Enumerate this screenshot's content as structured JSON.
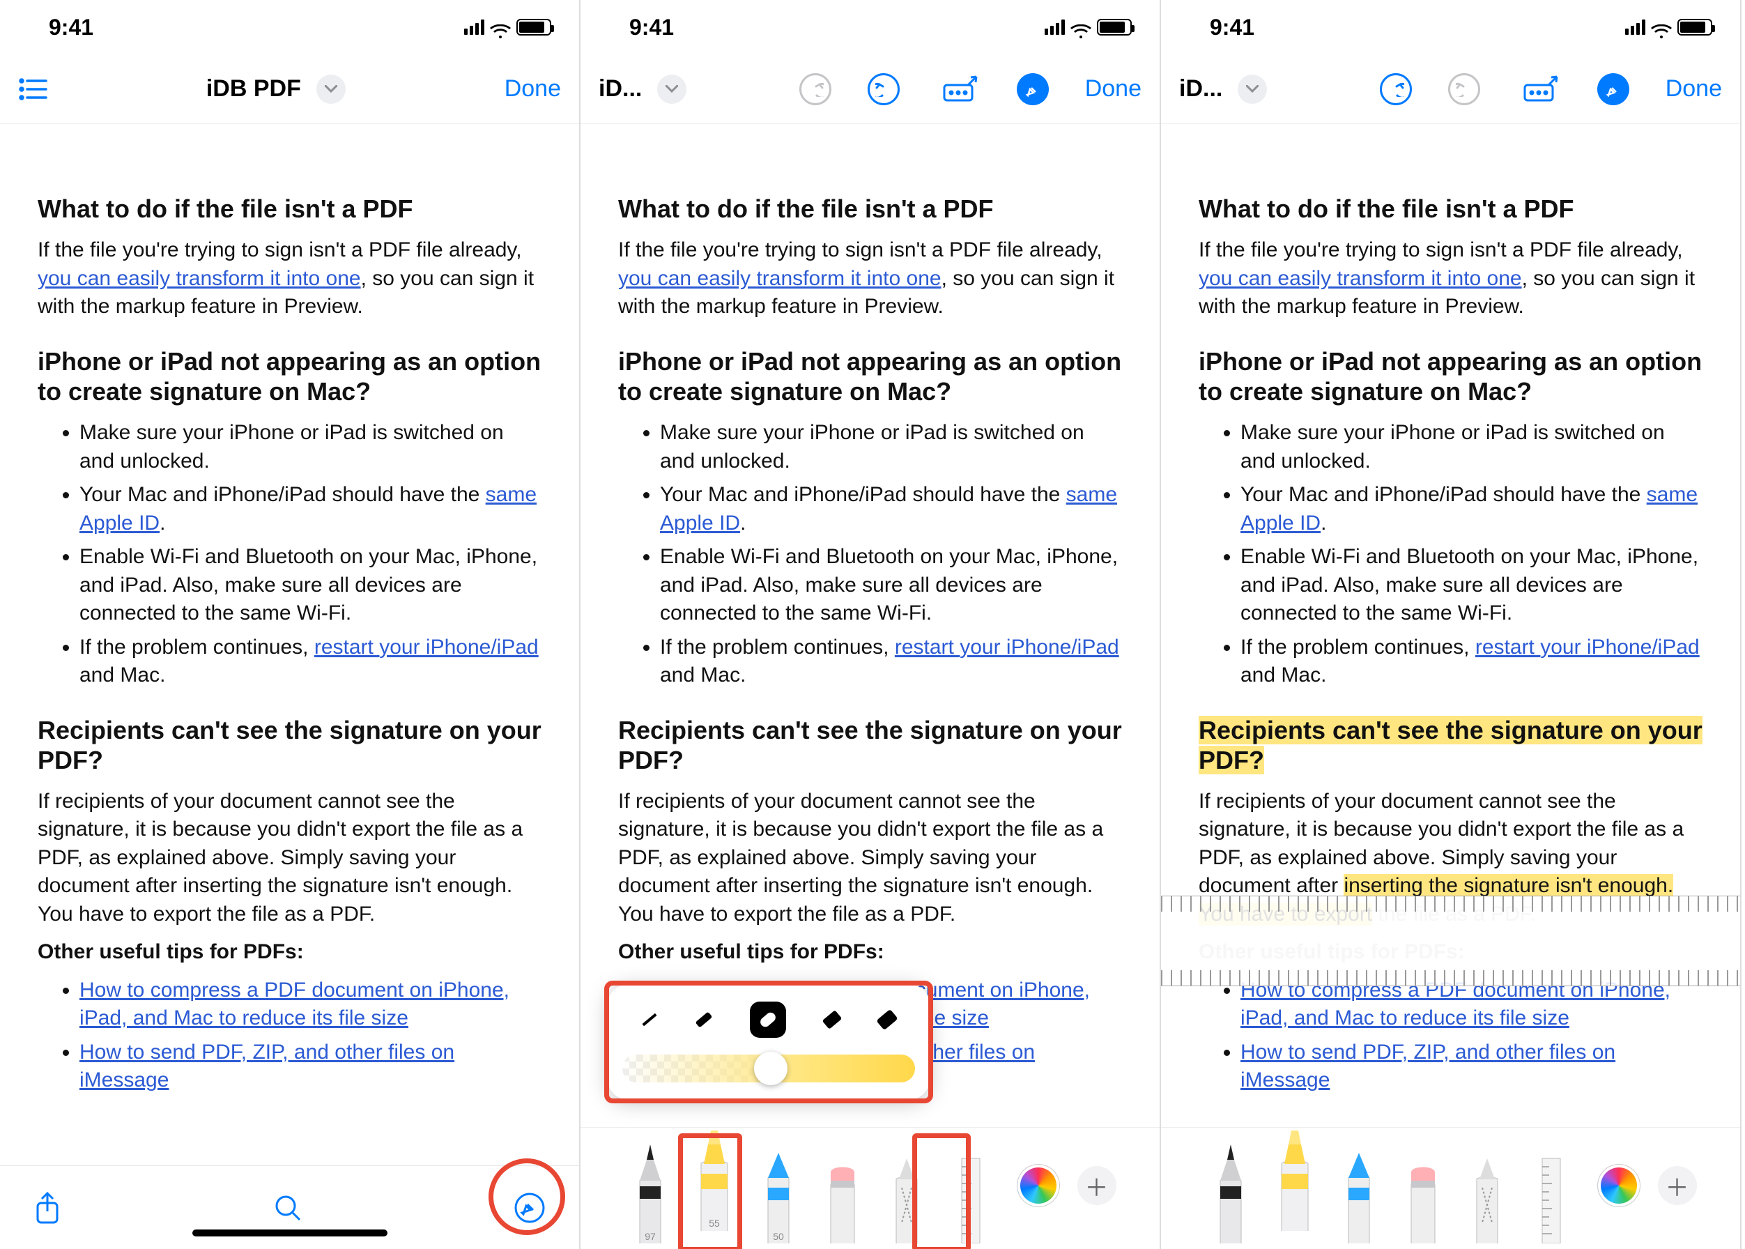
{
  "statusbar": {
    "time": "9:41"
  },
  "pane1": {
    "nav": {
      "title": "iDB PDF",
      "done": "Done"
    }
  },
  "pane2": {
    "nav": {
      "titleTrunc": "iD...",
      "done": "Done"
    }
  },
  "pane3": {
    "nav": {
      "titleTrunc": "iD...",
      "done": "Done"
    }
  },
  "doc": {
    "h1": "What to do if the file isn't a PDF",
    "p1a": "If the file you're trying to sign isn't a PDF file already, ",
    "p1link": "you can easily transform it into one",
    "p1b": ", so you can sign it with the markup feature in Preview.",
    "h2": "iPhone or iPad not appearing as an option to create signature on Mac?",
    "li1": "Make sure your iPhone or iPad is switched on and unlocked.",
    "li2a": "Your Mac and iPhone/iPad should have the ",
    "li2link": "same Apple ID",
    "li2b": ".",
    "li3": "Enable Wi-Fi and Bluetooth on your Mac, iPhone, and iPad. Also, make sure all devices are connected to the same Wi-Fi.",
    "li4a": "If the problem continues, ",
    "li4link": "restart your iPhone/iPad",
    "li4b": " and Mac.",
    "h3": "Recipients can't see the signature on your PDF?",
    "p3line1": "If recipients of your document cannot see the signature, it is because you didn't export the file as a PDF, as explained above. Simply saving your document after ",
    "p3hl_line": "inserting the signature isn't enough. You have to export",
    "p3line_tail": " the file as a PDF.",
    "h4": "Other useful tips for PDFs:",
    "tipsLink1": "How to compress a PDF document on iPhone, iPad, and Mac to reduce its file size",
    "tipsLink2": "How to send PDF, ZIP, and other files on iMessage"
  },
  "tools": {
    "penNums": {
      "pen": "97",
      "hiliter": "55",
      "pencil": "50"
    }
  }
}
